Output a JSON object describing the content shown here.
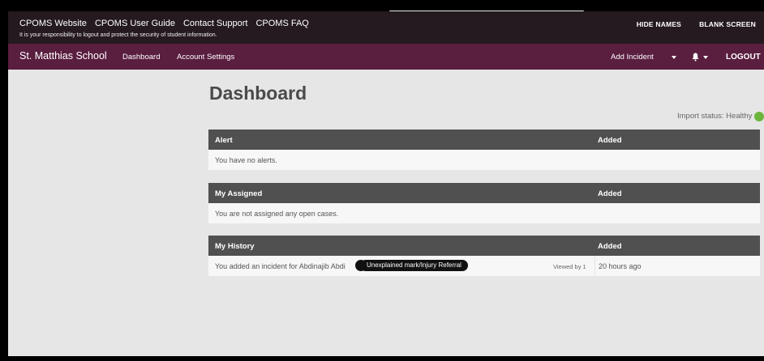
{
  "utility_bar": {
    "links": [
      "CPOMS Website",
      "CPOMS User Guide",
      "Contact Support",
      "CPOMS FAQ"
    ],
    "notice": "It is your responsibility to logout and protect the security of student information.",
    "hide_names": "HIDE NAMES",
    "blank_screen": "BLANK SCREEN"
  },
  "nav": {
    "school": "St. Matthias School",
    "dashboard": "Dashboard",
    "account_settings": "Account Settings",
    "add_incident": "Add Incident",
    "logout": "LOGOUT"
  },
  "page": {
    "title": "Dashboard",
    "import_status": "Import status: Healthy"
  },
  "panels": {
    "alert": {
      "title": "Alert",
      "added": "Added",
      "message": "You have no alerts."
    },
    "assigned": {
      "title": "My Assigned",
      "added": "Added",
      "message": "You are not assigned any open cases."
    },
    "history": {
      "title": "My History",
      "added": "Added",
      "item": {
        "text": "You added an incident for Abdinajib Abdi",
        "tag": "Unexplained mark/Injury Referral",
        "viewed": "Viewed by 1",
        "time": "20 hours ago"
      }
    }
  },
  "colors": {
    "utility_bg": "#241a1f",
    "nav_bg": "#5a1e3f",
    "panel_header": "#505050",
    "status_healthy": "#6bb53d"
  },
  "icons": [
    "bell-icon",
    "chevron-down-icon",
    "status-dot"
  ]
}
